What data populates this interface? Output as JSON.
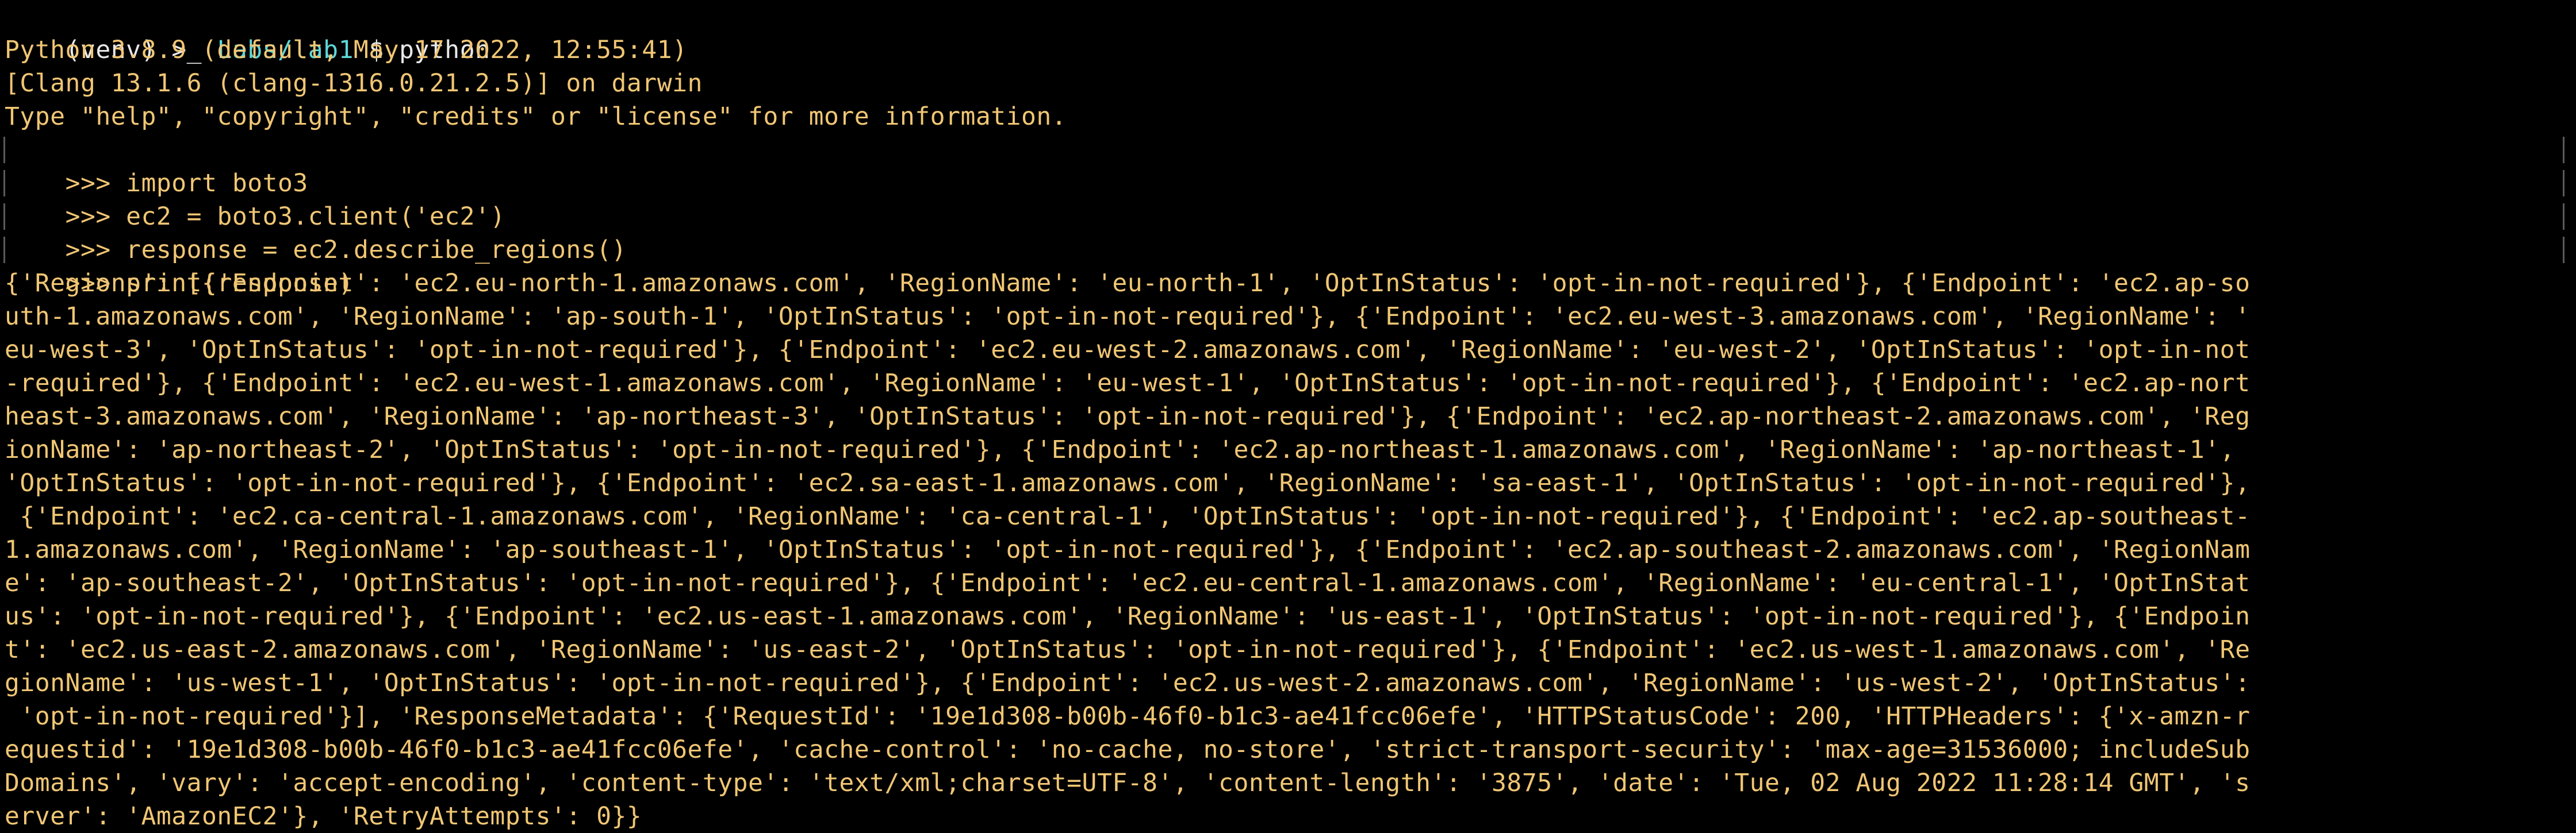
{
  "prompt": {
    "venv": "(venv)",
    "arrow": ">_",
    "path": "Labs/lab1",
    "symbol": "$",
    "command": "python"
  },
  "banner": [
    "Python 3.8.9 (default, May 17 2022, 12:55:41)",
    "[Clang 13.1.6 (clang-1316.0.21.2.5)] on darwin",
    "Type \"help\", \"copyright\", \"credits\" or \"license\" for more information."
  ],
  "repl": [
    {
      "prompt": ">>>",
      "code": "import boto3"
    },
    {
      "prompt": ">>>",
      "code": "ec2 = boto3.client('ec2')"
    },
    {
      "prompt": ">>>",
      "code": "response = ec2.describe_regions()"
    },
    {
      "prompt": ">>>",
      "code": "print(response)"
    }
  ],
  "output_lines": [
    "{'Regions': [{'Endpoint': 'ec2.eu-north-1.amazonaws.com', 'RegionName': 'eu-north-1', 'OptInStatus': 'opt-in-not-required'}, {'Endpoint': 'ec2.ap-so",
    "uth-1.amazonaws.com', 'RegionName': 'ap-south-1', 'OptInStatus': 'opt-in-not-required'}, {'Endpoint': 'ec2.eu-west-3.amazonaws.com', 'RegionName': '",
    "eu-west-3', 'OptInStatus': 'opt-in-not-required'}, {'Endpoint': 'ec2.eu-west-2.amazonaws.com', 'RegionName': 'eu-west-2', 'OptInStatus': 'opt-in-not",
    "-required'}, {'Endpoint': 'ec2.eu-west-1.amazonaws.com', 'RegionName': 'eu-west-1', 'OptInStatus': 'opt-in-not-required'}, {'Endpoint': 'ec2.ap-nort",
    "heast-3.amazonaws.com', 'RegionName': 'ap-northeast-3', 'OptInStatus': 'opt-in-not-required'}, {'Endpoint': 'ec2.ap-northeast-2.amazonaws.com', 'Reg",
    "ionName': 'ap-northeast-2', 'OptInStatus': 'opt-in-not-required'}, {'Endpoint': 'ec2.ap-northeast-1.amazonaws.com', 'RegionName': 'ap-northeast-1',",
    "'OptInStatus': 'opt-in-not-required'}, {'Endpoint': 'ec2.sa-east-1.amazonaws.com', 'RegionName': 'sa-east-1', 'OptInStatus': 'opt-in-not-required'},",
    " {'Endpoint': 'ec2.ca-central-1.amazonaws.com', 'RegionName': 'ca-central-1', 'OptInStatus': 'opt-in-not-required'}, {'Endpoint': 'ec2.ap-southeast-",
    "1.amazonaws.com', 'RegionName': 'ap-southeast-1', 'OptInStatus': 'opt-in-not-required'}, {'Endpoint': 'ec2.ap-southeast-2.amazonaws.com', 'RegionNam",
    "e': 'ap-southeast-2', 'OptInStatus': 'opt-in-not-required'}, {'Endpoint': 'ec2.eu-central-1.amazonaws.com', 'RegionName': 'eu-central-1', 'OptInStat",
    "us': 'opt-in-not-required'}, {'Endpoint': 'ec2.us-east-1.amazonaws.com', 'RegionName': 'us-east-1', 'OptInStatus': 'opt-in-not-required'}, {'Endpoin",
    "t': 'ec2.us-east-2.amazonaws.com', 'RegionName': 'us-east-2', 'OptInStatus': 'opt-in-not-required'}, {'Endpoint': 'ec2.us-west-1.amazonaws.com', 'Re",
    "gionName': 'us-west-1', 'OptInStatus': 'opt-in-not-required'}, {'Endpoint': 'ec2.us-west-2.amazonaws.com', 'RegionName': 'us-west-2', 'OptInStatus':",
    " 'opt-in-not-required'}], 'ResponseMetadata': {'RequestId': '19e1d308-b00b-46f0-b1c3-ae41fcc06efe', 'HTTPStatusCode': 200, 'HTTPHeaders': {'x-amzn-r",
    "equestid': '19e1d308-b00b-46f0-b1c3-ae41fcc06efe', 'cache-control': 'no-cache, no-store', 'strict-transport-security': 'max-age=31536000; includeSub",
    "Domains', 'vary': 'accept-encoding', 'content-type': 'text/xml;charset=UTF-8', 'content-length': '3875', 'date': 'Tue, 02 Aug 2022 11:28:14 GMT', 's",
    "erver': 'AmazonEC2'}, 'RetryAttempts': 0}}"
  ],
  "colors": {
    "background": "#000000",
    "text": "#f0c674",
    "path": "#5fd7d7",
    "prompt": "#e8e8e8"
  }
}
